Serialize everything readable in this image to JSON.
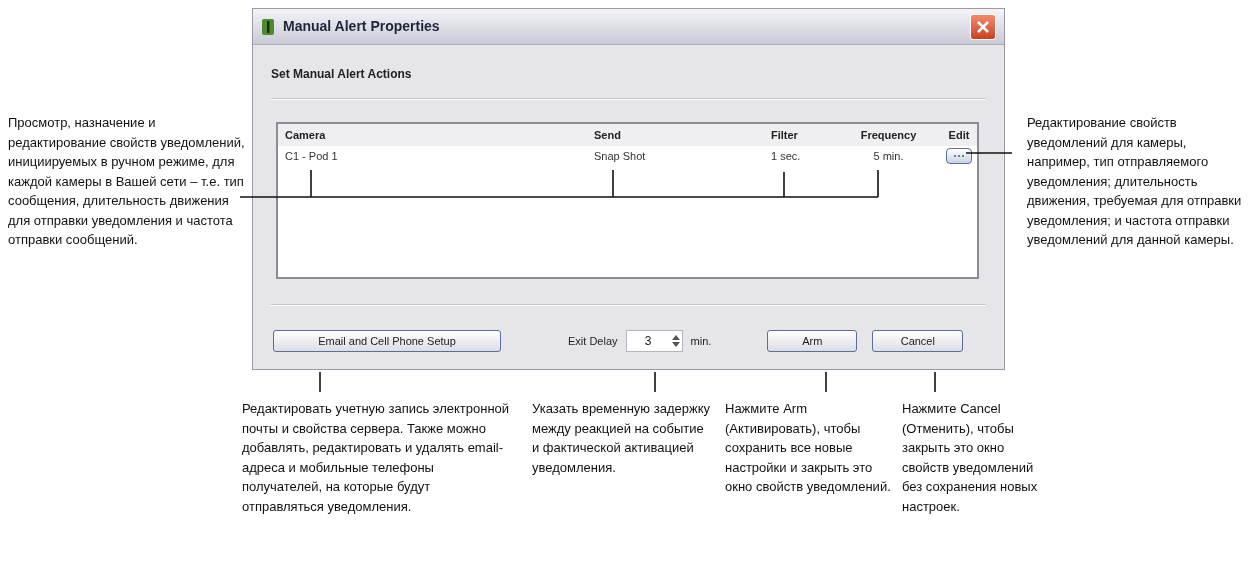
{
  "window": {
    "title": "Manual Alert Properties"
  },
  "section_title": "Set Manual Alert Actions",
  "table": {
    "columns": [
      "Camera",
      "Send",
      "Filter",
      "Frequency",
      "Edit"
    ],
    "rows": [
      {
        "cells": [
          "C1 - Pod 1",
          "Snap Shot",
          "1 sec.",
          "5 min."
        ]
      }
    ]
  },
  "setup_button": "Email and Cell Phone Setup",
  "exit_delay": {
    "label": "Exit Delay",
    "value": "3",
    "unit": "min."
  },
  "buttons": [
    "Arm",
    "Cancel"
  ],
  "callouts": [
    {
      "text": "Просмотр, назначение и редактирование свойств уведомлений, инициируемых в ручном режиме, для каждой камеры в Вашей сети – т.е. тип сообщения, длительность движения для отправки уведомления и частота отправки сообщений."
    },
    {
      "text": "Редактирование свойств уведомлений для камеры, например, тип отправляемого уведомления; длительность движения, требуемая для отправки уведомления; и частота отправки уведомлений для данной камеры."
    },
    {
      "text": "Редактировать учетную запись электронной почты и свойства сервера. Также можно добавлять, редактировать и удалять email-адреса и мобильные телефоны получателей, на которые будут отправляться уведомления."
    },
    {
      "text": "Указать временную задержку между реакцией на событие и фактической активацией уведомления."
    },
    {
      "text": "Нажмите Arm (Активировать), чтобы сохранить все новые настройки и закрыть это окно свойств уведомлений."
    },
    {
      "text": "Нажмите Cancel (Отменить), чтобы закрыть это окно свойств уведомлений без сохранения новых настроек."
    }
  ]
}
